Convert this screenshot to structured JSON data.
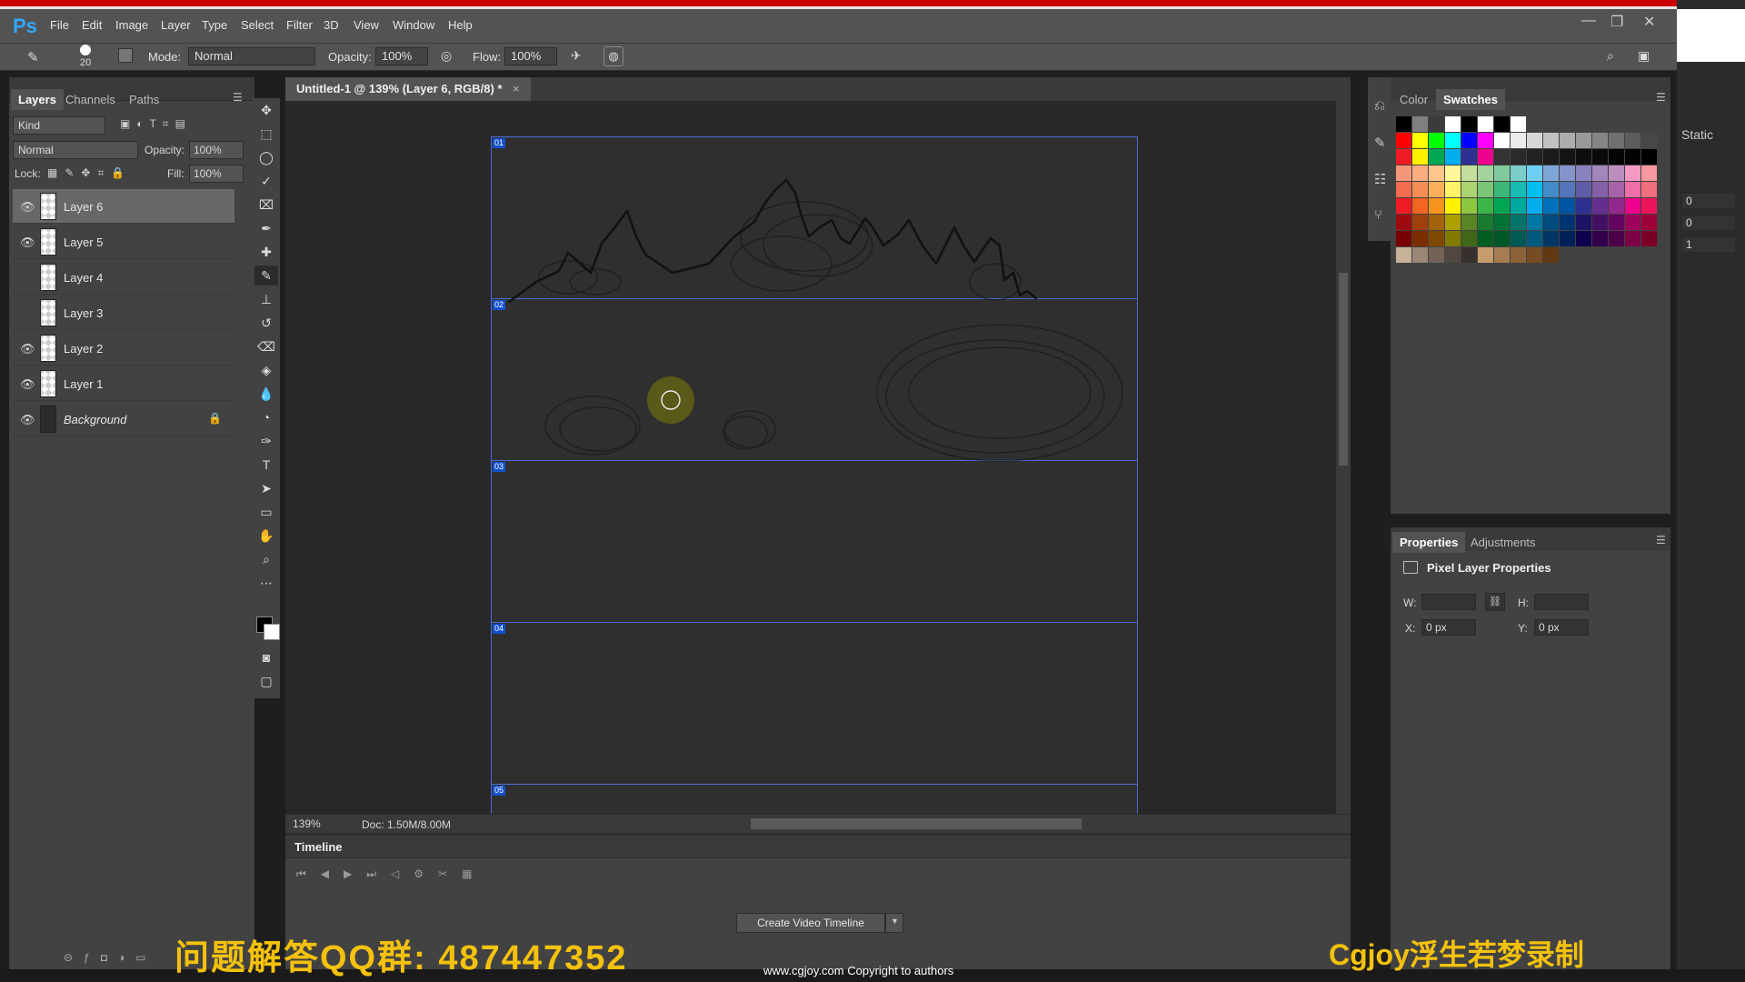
{
  "app": {
    "logo": "Ps"
  },
  "menu": [
    "File",
    "Edit",
    "Image",
    "Layer",
    "Type",
    "Select",
    "Filter",
    "3D",
    "View",
    "Window",
    "Help"
  ],
  "window_controls": {
    "minimize": "—",
    "restore": "❐",
    "close": "✕"
  },
  "options": {
    "brush_size": "20",
    "mode_label": "Mode:",
    "mode_value": "Normal",
    "opacity_label": "Opacity:",
    "opacity_value": "100%",
    "flow_label": "Flow:",
    "flow_value": "100%"
  },
  "layers_panel": {
    "tabs": [
      "Layers",
      "Channels",
      "Paths"
    ],
    "filter": "Kind",
    "blend_mode": "Normal",
    "opacity_label": "Opacity:",
    "opacity_value": "100%",
    "lock_label": "Lock:",
    "fill_label": "Fill:",
    "fill_value": "100%",
    "layers": [
      {
        "name": "Layer 6",
        "visible": true,
        "selected": true
      },
      {
        "name": "Layer 5",
        "visible": true
      },
      {
        "name": "Layer 4",
        "visible": false
      },
      {
        "name": "Layer 3",
        "visible": false
      },
      {
        "name": "Layer 2",
        "visible": true
      },
      {
        "name": "Layer 1",
        "visible": true
      },
      {
        "name": "Background",
        "visible": true,
        "locked": true
      }
    ]
  },
  "document": {
    "tab_title": "Untitled-1 @ 139% (Layer 6, RGB/8) *",
    "close_glyph": "×",
    "zoom": "139%",
    "doc_size": "Doc: 1.50M/8.00M",
    "slices": [
      "01",
      "02",
      "03",
      "04",
      "05"
    ]
  },
  "timeline": {
    "title": "Timeline",
    "create_button": "Create Video Timeline"
  },
  "swatch_panel": {
    "tabs": [
      "Color",
      "Swatches"
    ],
    "colors": {
      "row1": [
        "#000000",
        "#7f7f7f",
        "#3b3b3b",
        "#ffffff",
        "#000000",
        "#ffffff",
        "#000000",
        "#ffffff"
      ],
      "row2": [
        "#ff0000",
        "#ffff00",
        "#00ff00",
        "#00ffff",
        "#0000ff",
        "#ff00ff",
        "#ffffff",
        "#ebebeb",
        "#d6d6d6",
        "#c2c2c2",
        "#adadad",
        "#999999",
        "#858585",
        "#707070",
        "#5c5c5c",
        "#474747"
      ],
      "row3": [
        "#ee1c24",
        "#fff200",
        "#00a651",
        "#00aeef",
        "#2e3192",
        "#ec008c",
        "#333333",
        "#2a2a2a",
        "#222222",
        "#1b1b1b",
        "#141414",
        "#0e0e0e",
        "#0a0a0a",
        "#060606",
        "#030303",
        "#000000"
      ],
      "row4": [
        "#f7977a",
        "#f9ad81",
        "#fdc68a",
        "#fff79a",
        "#c4df9b",
        "#a3d39c",
        "#82ca9d",
        "#7bcdc8",
        "#6ecff6",
        "#7ea7d8",
        "#8493ca",
        "#8882be",
        "#a187be",
        "#bc8dbf",
        "#f49ac2",
        "#f6989d"
      ],
      "row5": [
        "#f26c4f",
        "#f68e55",
        "#fbaf5c",
        "#fff467",
        "#acd372",
        "#7cc576",
        "#3bb878",
        "#1abbb4",
        "#00bff3",
        "#438cca",
        "#5574b9",
        "#605ca8",
        "#855fa8",
        "#a763a8",
        "#f06eaa",
        "#f26d7d"
      ],
      "row6": [
        "#ed1c24",
        "#f26522",
        "#f7941d",
        "#fff200",
        "#8dc73f",
        "#39b54a",
        "#00a651",
        "#00a99d",
        "#00aeef",
        "#0072bc",
        "#0054a6",
        "#2e3192",
        "#662d91",
        "#92278f",
        "#ec008c",
        "#ed145b"
      ],
      "row7": [
        "#9e0b0f",
        "#a0410d",
        "#a36209",
        "#aba000",
        "#598527",
        "#1a7b30",
        "#007236",
        "#00746b",
        "#0076a3",
        "#004b80",
        "#003471",
        "#1b1464",
        "#440e62",
        "#630460",
        "#9e005d",
        "#9e0039"
      ],
      "row8": [
        "#790000",
        "#7b2e00",
        "#7d4900",
        "#827b00",
        "#406618",
        "#005e20",
        "#005826",
        "#005952",
        "#005b7f",
        "#003663",
        "#002157",
        "#0d004c",
        "#32004b",
        "#4b0049",
        "#7b0046",
        "#7a0026"
      ],
      "row9": [
        "#c7b299",
        "#998675",
        "#736357",
        "#534741",
        "#37302d",
        "#c69c6d",
        "#a67c52",
        "#8c6239",
        "#754c24",
        "#603913"
      ]
    }
  },
  "properties": {
    "tabs": [
      "Properties",
      "Adjustments"
    ],
    "title": "Pixel Layer Properties",
    "w_label": "W:",
    "h_label": "H:",
    "x_label": "X:",
    "x_value": "0 px",
    "y_label": "Y:",
    "y_value": "0 px"
  },
  "right_side": {
    "static_label": "Static",
    "fields": [
      "0",
      "0",
      "1"
    ]
  },
  "captions": {
    "qq": "问题解答QQ群: 487447352",
    "cgjoy": "Cgjoy浮生若梦录制",
    "copyright": "www.cgjoy.com Copyright to authors"
  }
}
